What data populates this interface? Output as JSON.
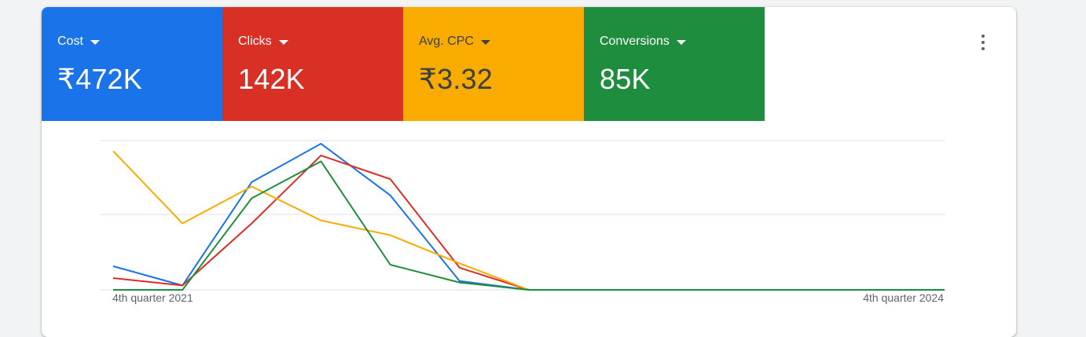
{
  "metrics": [
    {
      "label": "Cost",
      "value": "₹472K",
      "bg": "#1a73e8",
      "fg": "#ffffff"
    },
    {
      "label": "Clicks",
      "value": "142K",
      "bg": "#d93025",
      "fg": "#ffffff"
    },
    {
      "label": "Avg. CPC",
      "value": "₹3.32",
      "bg": "#f9ab00",
      "fg": "#3c4043"
    },
    {
      "label": "Conversions",
      "value": "85K",
      "bg": "#1e8e3e",
      "fg": "#ffffff"
    }
  ],
  "menu_icon": "more-vert-icon",
  "chart_data": {
    "type": "line",
    "x_first_label": "4th quarter 2021",
    "x_last_label": "4th quarter 2024",
    "x_points": 13,
    "grid": true,
    "series": [
      {
        "metric": "Cost",
        "color": "#1a73e8",
        "values": [
          16,
          3,
          73,
          99,
          64,
          6,
          0,
          0,
          0,
          0,
          0,
          0,
          0
        ]
      },
      {
        "metric": "Clicks",
        "color": "#d93025",
        "values": [
          8,
          3,
          45,
          91,
          75,
          15,
          0,
          0,
          0,
          0,
          0,
          0,
          0
        ]
      },
      {
        "metric": "Avg. CPC",
        "color": "#f9ab00",
        "values": [
          94,
          45,
          70,
          47,
          37,
          18,
          0,
          0,
          0,
          0,
          0,
          0,
          0
        ]
      },
      {
        "metric": "Conversions",
        "color": "#1e8e3e",
        "values": [
          0,
          0,
          62,
          87,
          17,
          5,
          0,
          0,
          0,
          0,
          0,
          0,
          0
        ]
      }
    ]
  }
}
